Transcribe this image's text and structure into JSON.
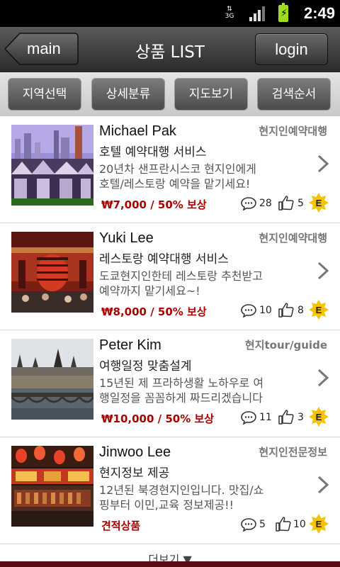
{
  "status_bar": {
    "network": "3G",
    "time": "2:49"
  },
  "header": {
    "back_label": "main",
    "title": "상품 LIST",
    "login_label": "login"
  },
  "tabs": [
    {
      "label": "지역선택"
    },
    {
      "label": "상세분류"
    },
    {
      "label": "지도보기"
    },
    {
      "label": "검색순서"
    }
  ],
  "items": [
    {
      "name": "Michael Pak",
      "category": "현지인예약대행",
      "service": "호텔 예약대행 서비스",
      "desc_line1": "20년차 샌프란시스코 현지인에게",
      "desc_line2": "호텔/레스토랑 예약을 맡기세요!",
      "price": "₩7,000 / 50% 보상",
      "comments": "28",
      "likes": "5",
      "badge": "E"
    },
    {
      "name": "Yuki Lee",
      "category": "현지인예약대행",
      "service": "레스토랑 예약대행 서비스",
      "desc_line1": "도쿄현지인한테 레스토랑 추천받고",
      "desc_line2": "예약까지 맡기세요~!",
      "price": "₩8,000 / 50% 보상",
      "comments": "10",
      "likes": "8",
      "badge": "E"
    },
    {
      "name": "Peter Kim",
      "category": "현지tour/guide",
      "service": "여행일정 맞춤설계",
      "desc_line1": "15년된 제 프라하생활 노하우로 여",
      "desc_line2": "행일정을 꼼꼼하게 짜드리겠습니다",
      "price": "₩10,000 / 50% 보상",
      "comments": "11",
      "likes": "3",
      "badge": "E"
    },
    {
      "name": "Jinwoo Lee",
      "category": "현지인전문정보",
      "service": "현지정보 제공",
      "desc_line1": "12년된 북경현지인입니다. 맛집/쇼",
      "desc_line2": "핑부터 이민,교육 정보제공!!",
      "price": "견적상품",
      "comments": "5",
      "likes": "10",
      "badge": "E"
    }
  ],
  "footer": {
    "more_label": "더보기 ▼"
  },
  "colors": {
    "price": "#aa0000",
    "badge": "#f5c400",
    "header": "#3a3a3a",
    "bottom": "#5a0d12"
  }
}
